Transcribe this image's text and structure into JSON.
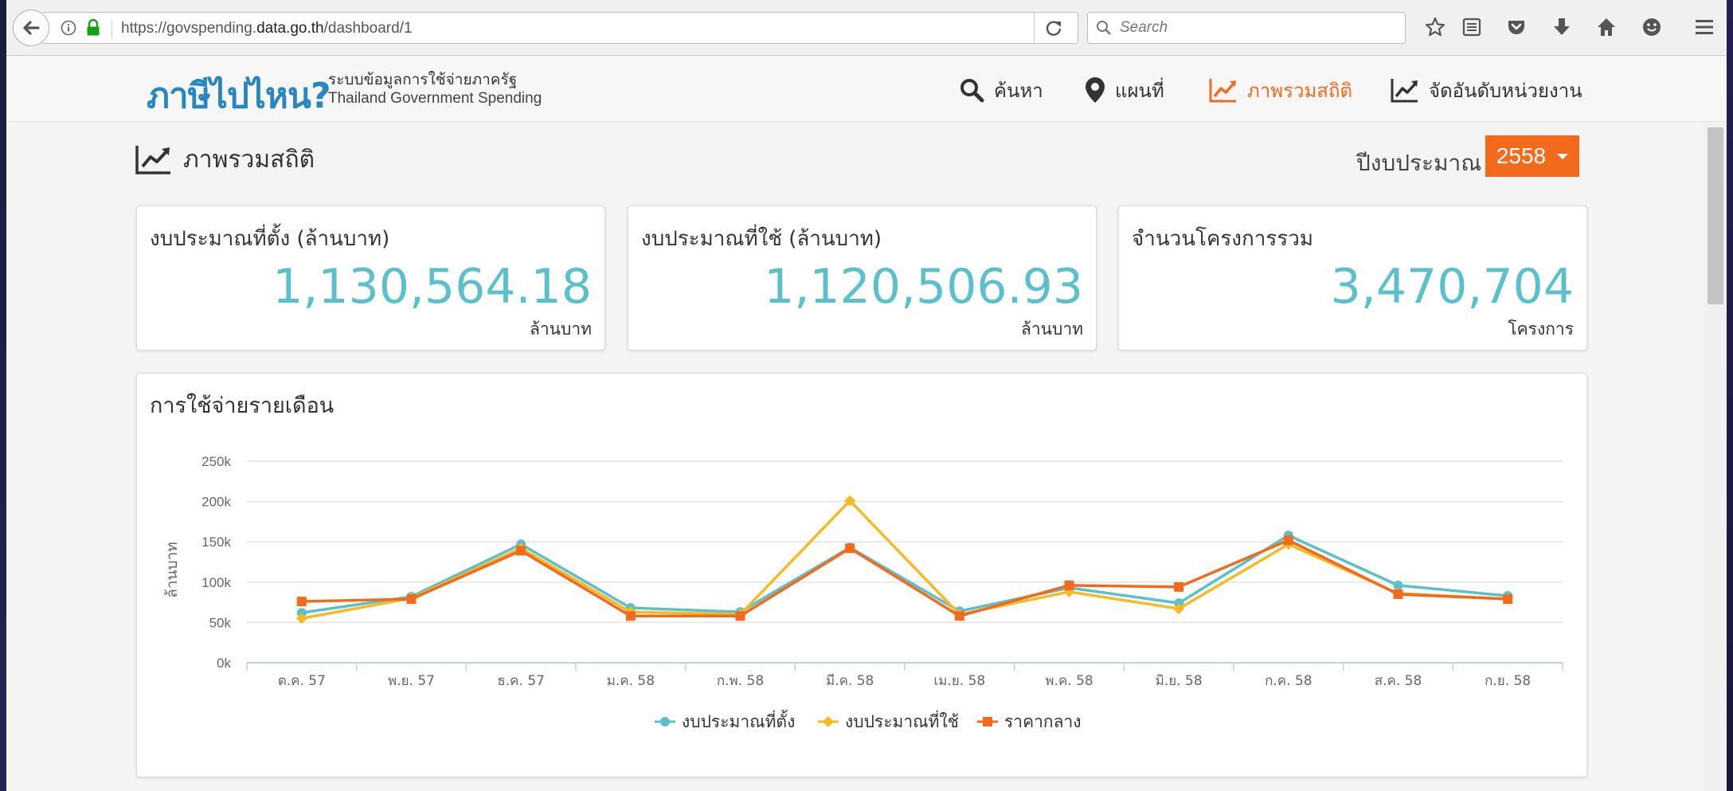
{
  "browser": {
    "url_prefix": "https://govspending.",
    "url_domain": "data.go.th",
    "url_path": "/dashboard/1",
    "search_placeholder": "Search"
  },
  "site": {
    "logo": "ภาษีไปไหน?",
    "tagline_th": "ระบบข้อมูลการใช้จ่ายภาครัฐ",
    "tagline_en": "Thailand Government Spending",
    "nav": [
      {
        "label": "ค้นหา",
        "icon": "search-icon"
      },
      {
        "label": "แผนที่",
        "icon": "map-pin-icon"
      },
      {
        "label": "ภาพรวมสถิติ",
        "icon": "trend-chart-icon",
        "active": true
      },
      {
        "label": "จัดอันดับหน่วยงาน",
        "icon": "trend-chart-icon"
      }
    ],
    "accent_color": "#f26b1d"
  },
  "page": {
    "title": "ภาพรวมสถิติ",
    "year_label": "ปีงบประมาณ",
    "year_value": "2558"
  },
  "stats": [
    {
      "title": "งบประมาณที่ตั้ง (ล้านบาท)",
      "value": "1,130,564.18",
      "unit": "ล้านบาท"
    },
    {
      "title": "งบประมาณที่ใช้ (ล้านบาท)",
      "value": "1,120,506.93",
      "unit": "ล้านบาท"
    },
    {
      "title": "จำนวนโครงการรวม",
      "value": "3,470,704",
      "unit": "โครงการ"
    }
  ],
  "chart_data": {
    "type": "line",
    "title": "การใช้จ่ายรายเดือน",
    "ylabel": "ล้านบาท",
    "xlabel": "",
    "ylim": [
      0,
      250000
    ],
    "y_ticks": [
      "0k",
      "50k",
      "100k",
      "150k",
      "200k",
      "250k"
    ],
    "y_tick_values": [
      0,
      50000,
      100000,
      150000,
      200000,
      250000
    ],
    "categories": [
      "ต.ค. 57",
      "พ.ย. 57",
      "ธ.ค. 57",
      "ม.ค. 58",
      "ก.พ. 58",
      "มี.ค. 58",
      "เม.ย. 58",
      "พ.ค. 58",
      "มิ.ย. 58",
      "ก.ค. 58",
      "ส.ค. 58",
      "ก.ย. 58"
    ],
    "grid": true,
    "legend": "bottom-center",
    "series": [
      {
        "name": "งบประมาณที่ตั้ง",
        "color": "#5bc0cc",
        "marker": "circle",
        "values": [
          62000,
          82000,
          147000,
          68000,
          63000,
          143000,
          64000,
          93000,
          74000,
          158000,
          96000,
          83000
        ]
      },
      {
        "name": "งบประมาณที่ใช้",
        "color": "#f7b924",
        "marker": "diamond",
        "values": [
          55000,
          80000,
          142000,
          63000,
          60000,
          201000,
          60000,
          88000,
          67000,
          147000,
          86000,
          79000
        ]
      },
      {
        "name": "ราคากลาง",
        "color": "#f26b1d",
        "marker": "square",
        "values": [
          76000,
          79000,
          139000,
          58000,
          58000,
          142000,
          58000,
          96000,
          94000,
          152000,
          85000,
          79000
        ]
      }
    ]
  }
}
